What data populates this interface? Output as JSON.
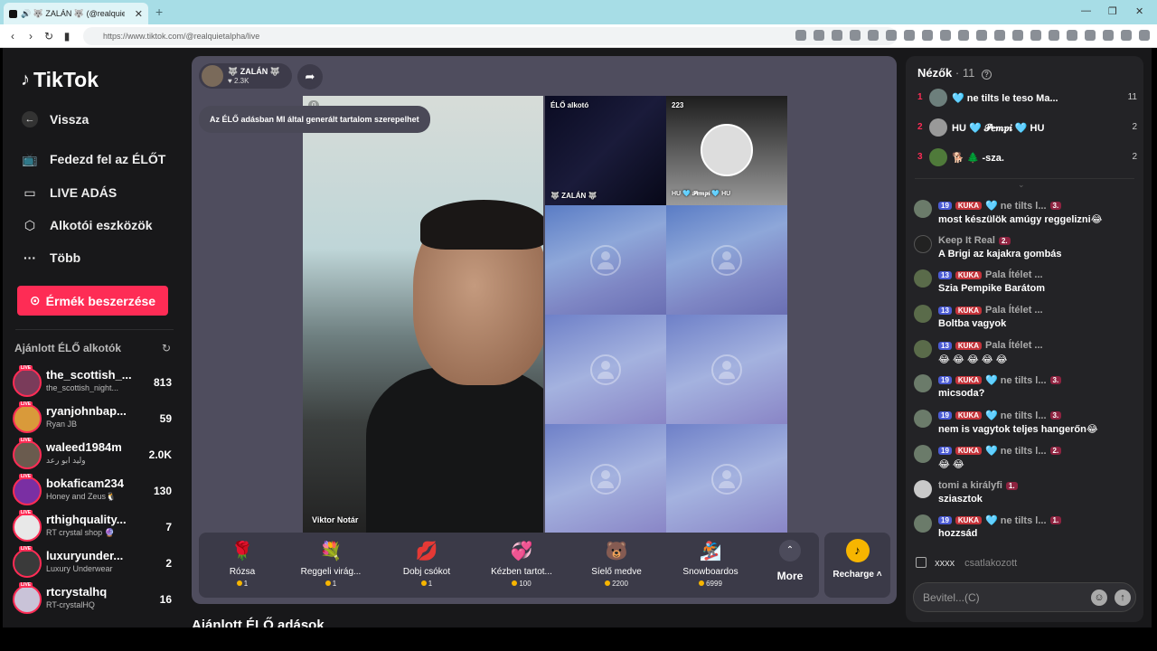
{
  "browser": {
    "tab_title": "🔊 🐺 ZALÁN 🐺 (@realquietalpha) ...",
    "url": "https://www.tiktok.com/@realquietalpha/live"
  },
  "sidebar": {
    "logo": "TikTok",
    "back": "Vissza",
    "nav": [
      {
        "label": "Fedezd fel az ÉLŐT",
        "icon": "tv-icon"
      },
      {
        "label": "LIVE ADÁS",
        "icon": "camera-icon"
      },
      {
        "label": "Alkotói eszközök",
        "icon": "creator-tools-icon"
      },
      {
        "label": "Több",
        "icon": "more-icon"
      }
    ],
    "coins_button": "Érmék beszerzése",
    "recommended_title": "Ajánlott ÉLŐ alkotók",
    "live_badge": "LIVE",
    "creators": [
      {
        "name": "the_scottish_...",
        "sub": "the_scottish_night...",
        "count": "813"
      },
      {
        "name": "ryanjohnbap...",
        "sub": "Ryan JB",
        "count": "59"
      },
      {
        "name": "waleed1984m",
        "sub": "وليد ابو رعد",
        "count": "2.0K"
      },
      {
        "name": "bokaficam234",
        "sub": "Honey and Zeus🐧",
        "count": "130"
      },
      {
        "name": "rthighquality...",
        "sub": "RT crystal shop 🔮",
        "count": "7"
      },
      {
        "name": "luxuryunder...",
        "sub": "Luxury Underwear",
        "count": "2"
      },
      {
        "name": "rtcrystalhq",
        "sub": "RT-crystalHQ",
        "count": "16"
      }
    ]
  },
  "stage": {
    "host_name": "🐺 ZALÁN 🐺",
    "host_likes": "♥ 2.3K",
    "ai_notice": "Az ÉLŐ adásban MI által generált tartalom szerepelhet",
    "main_viewers": "0",
    "main_label": "Viktor Notár",
    "cell1_label": "ÉLŐ alkotó",
    "cell1_name": "🐺 ZALÁN 🐺",
    "cell2_viewers": "223",
    "cell2_name": "HU 🩵 𝓟𝒆𝒎𝒑𝒊 🩵 HU"
  },
  "gifts": [
    {
      "name": "Rózsa",
      "price": "1",
      "glyph": "🌹"
    },
    {
      "name": "Reggeli virág...",
      "price": "1",
      "glyph": "💐"
    },
    {
      "name": "Dobj csókot",
      "price": "1",
      "glyph": "💋"
    },
    {
      "name": "Kézben tartot...",
      "price": "100",
      "glyph": "💞"
    },
    {
      "name": "Síelő medve",
      "price": "2200",
      "glyph": "🐻"
    },
    {
      "name": "Snowboardos",
      "price": "6999",
      "glyph": "🏂"
    }
  ],
  "gift_more": "More",
  "recharge": "Recharge ˄",
  "recommended_lives": "Ajánlott ÉLŐ adások",
  "chat": {
    "viewers_label": "Nézők",
    "viewers_count": "· 11",
    "top_viewers": [
      {
        "rank": "1",
        "name": "🩵 ne tilts le teso Ma...",
        "score": "11",
        "rank_color": "#fe2c55"
      },
      {
        "rank": "2",
        "name": "HU 🩵 𝓟𝒆𝒎𝒑𝒊 🩵 HU",
        "score": "2",
        "rank_color": "#fe2c55"
      },
      {
        "rank": "3",
        "name": "🐕 🌲 -sza.",
        "score": "2",
        "rank_color": "#fe2c55"
      }
    ],
    "messages": [
      {
        "badges": [
          "19",
          "KUKA"
        ],
        "user": "🩵 ne tilts l...",
        "rank": "3.",
        "text": "most készülök amúgy reggelizni😂"
      },
      {
        "badges": [],
        "user": "Keep It Real",
        "rank": "2.",
        "text": "A Brigi az kajakra gombás"
      },
      {
        "badges": [
          "13",
          "KUKA"
        ],
        "user": "Pala Ítélet ...",
        "rank": "",
        "text": "Szia Pempike Barátom"
      },
      {
        "badges": [
          "13",
          "KUKA"
        ],
        "user": "Pala Ítélet ...",
        "rank": "",
        "text": "Boltba vagyok"
      },
      {
        "badges": [
          "13",
          "KUKA"
        ],
        "user": "Pala Ítélet ...",
        "rank": "",
        "text": "😂 😂 😂 😂 😂"
      },
      {
        "badges": [
          "19",
          "KUKA"
        ],
        "user": "🩵 ne tilts l...",
        "rank": "3.",
        "text": "micsoda?"
      },
      {
        "badges": [
          "19",
          "KUKA"
        ],
        "user": "🩵 ne tilts l...",
        "rank": "3.",
        "text": "nem is vagytok teljes hangerőn😂"
      },
      {
        "badges": [
          "19",
          "KUKA"
        ],
        "user": "🩵 ne tilts l...",
        "rank": "2.",
        "text": "😂 😂"
      },
      {
        "badges": [],
        "user": "tomi a királyfi",
        "rank": "1.",
        "text": "sziasztok"
      },
      {
        "badges": [
          "19",
          "KUKA"
        ],
        "user": "🩵 ne tilts l...",
        "rank": "1.",
        "text": "hozzsád"
      }
    ],
    "joined_user": "xxxx",
    "joined_text": "csatlakozott",
    "input_placeholder": "Bevitel...(C)"
  }
}
